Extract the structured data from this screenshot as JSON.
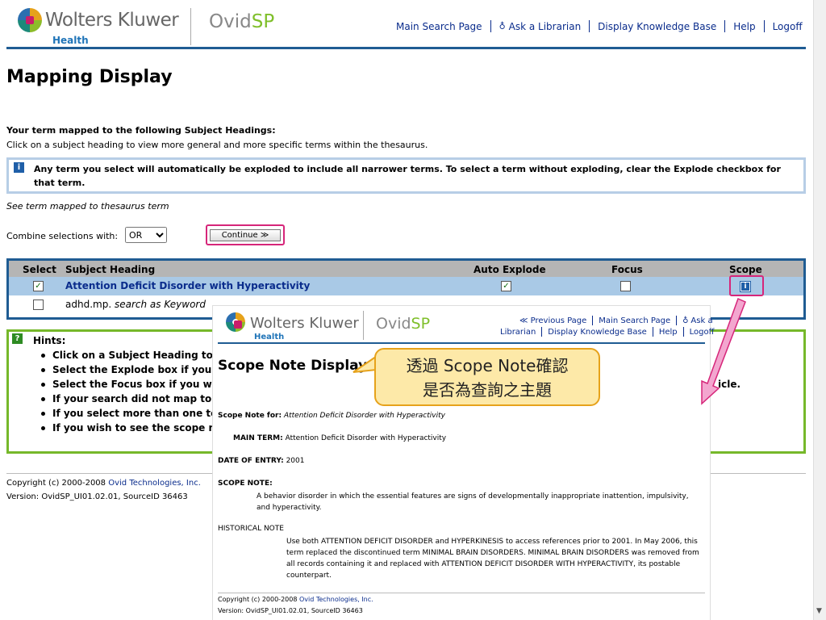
{
  "header": {
    "brand": "Wolters Kluwer",
    "brand_sub": "Health",
    "product_prefix": "Ovid",
    "product_suffix": "SP",
    "nav": [
      "Main Search Page",
      "Ask a Librarian",
      "Display Knowledge Base",
      "Help",
      "Logoff"
    ]
  },
  "page_title": "Mapping Display",
  "intro_bold": "Your term mapped to the following Subject Headings:",
  "intro_text": "Click on a subject heading to view more general and more specific terms within the thesaurus.",
  "info_text": "Any term you select will automatically be exploded to include all narrower terms. To select a term without exploding, clear the Explode checkbox for that term.",
  "see_term": "See term mapped to thesaurus term",
  "combine_label": "Combine selections with:",
  "combine_value": "OR",
  "continue_label": "Continue ≫",
  "table": {
    "headers": [
      "Select",
      "Subject Heading",
      "Auto Explode",
      "Focus",
      "Scope"
    ],
    "row1_heading": "Attention Deficit Disorder with Hyperactivity",
    "row2_term": "adhd.mp.",
    "row2_suffix": "search as Keyword"
  },
  "hints": {
    "title": "Hints:",
    "items": [
      "Click on a Subject Heading to view",
      "Select the Explode box if you wish",
      "Select the Focus box if you wish to",
      "If your search did not map to a des",
      "If you select more than one term, y",
      "If you wish to see the scope note f"
    ],
    "trailing": "icle."
  },
  "footer": {
    "copyright_prefix": "Copyright (c) 2000-2008 ",
    "copyright_link": "Ovid Technologies, Inc.",
    "version": "Version: OvidSP_UI01.02.01, SourceID 36463"
  },
  "overlay": {
    "brand": "Wolters Kluwer",
    "brand_sub": "Health",
    "product_prefix": "Ovid",
    "product_suffix": "SP",
    "nav_row1": [
      "≪ Previous Page",
      "Main Search Page",
      "Ask a"
    ],
    "nav_row2": [
      "Librarian",
      "Display Knowledge Base",
      "Help",
      "Logoff"
    ],
    "title": "Scope Note Display",
    "scope_for_label": "Scope Note for:",
    "scope_for_value": "Attention Deficit Disorder with Hyperactivity",
    "main_term_label": "MAIN TERM:",
    "main_term_value": "Attention Deficit Disorder with Hyperactivity",
    "date_label": "DATE OF ENTRY:",
    "date_value": "2001",
    "scope_note_label": "SCOPE NOTE:",
    "scope_note_text": "A behavior disorder in which the essential features are signs of developmentally inappropriate inattention, impulsivity, and hyperactivity.",
    "hist_label": "HISTORICAL NOTE",
    "hist_text": "Use both ATTENTION DEFICIT DISORDER and HYPERKINESIS to access references prior to 2001. In May 2006, this term replaced the discontinued term MINIMAL BRAIN DISORDERS. MINIMAL BRAIN DISORDERS was removed from all records containing it and replaced with ATTENTION DEFICIT DISORDER WITH HYPERACTIVITY, its postable counterpart.",
    "copyright_prefix": "Copyright (c) 2000-2008 ",
    "copyright_link": "Ovid Technologies, Inc.",
    "version": "Version: OvidSP_UI01.02.01, SourceID 36463"
  },
  "callout": {
    "line1": "透過 Scope Note確認",
    "line2": "是否為查詢之主題"
  },
  "colors": {
    "accent_blue": "#1f5c93",
    "highlight_pink": "#d6267a",
    "hint_green": "#76b82a",
    "callout_fill": "#fde9a8"
  }
}
